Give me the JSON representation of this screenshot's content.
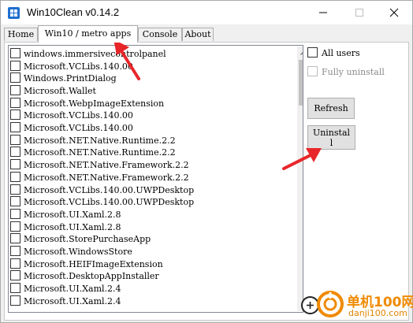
{
  "window": {
    "title": "Win10Clean v0.14.2"
  },
  "tabs": [
    {
      "label": "Home"
    },
    {
      "label": "Win10 / metro apps"
    },
    {
      "label": "Console"
    },
    {
      "label": "About"
    }
  ],
  "apps": [
    "windows.immersivecontrolpanel",
    "Microsoft.VCLibs.140.00",
    "Windows.PrintDialog",
    "Microsoft.Wallet",
    "Microsoft.WebpImageExtension",
    "Microsoft.VCLibs.140.00",
    "Microsoft.VCLibs.140.00",
    "Microsoft.NET.Native.Runtime.2.2",
    "Microsoft.NET.Native.Runtime.2.2",
    "Microsoft.NET.Native.Framework.2.2",
    "Microsoft.NET.Native.Framework.2.2",
    "Microsoft.VCLibs.140.00.UWPDesktop",
    "Microsoft.VCLibs.140.00.UWPDesktop",
    "Microsoft.UI.Xaml.2.8",
    "Microsoft.UI.Xaml.2.8",
    "Microsoft.StorePurchaseApp",
    "Microsoft.WindowsStore",
    "Microsoft.HEIFImageExtension",
    "Microsoft.DesktopAppInstaller",
    "Microsoft.UI.Xaml.2.4",
    "Microsoft.UI.Xaml.2.4"
  ],
  "options": {
    "all_users": "All users",
    "fully_uninstall": "Fully uninstall"
  },
  "buttons": {
    "refresh": "Refresh",
    "uninstall_line1": "Uninstal",
    "uninstall_line2": "l"
  },
  "watermark": {
    "line1": "单机100网",
    "line2": "danji100.com"
  },
  "colors": {
    "annotation_arrow": "#e8262a",
    "watermark": "#f08a00"
  }
}
